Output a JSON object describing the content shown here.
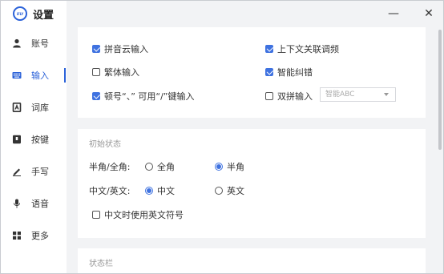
{
  "app": {
    "logo_text": "iFLY",
    "title": "设置"
  },
  "window_controls": {
    "minimize": "—",
    "close": "✕"
  },
  "sidebar": {
    "items": [
      {
        "label": "账号",
        "icon": "user-icon",
        "active": false
      },
      {
        "label": "输入",
        "icon": "keyboard-icon",
        "active": true
      },
      {
        "label": "词库",
        "icon": "dictionary-icon",
        "active": false
      },
      {
        "label": "按键",
        "icon": "key-icon",
        "active": false
      },
      {
        "label": "手写",
        "icon": "pen-icon",
        "active": false
      },
      {
        "label": "语音",
        "icon": "microphone-icon",
        "active": false
      },
      {
        "label": "更多",
        "icon": "grid-icon",
        "active": false
      }
    ]
  },
  "input_options": {
    "pinyin_cloud": {
      "label": "拼音云输入",
      "checked": true
    },
    "context_adjust": {
      "label": "上下文关联调频",
      "checked": true
    },
    "traditional": {
      "label": "繁体输入",
      "checked": false
    },
    "smart_correct": {
      "label": "智能纠错",
      "checked": true
    },
    "punctuation": {
      "label": "顿号“、” 可用“/”键输入",
      "checked": true
    },
    "double_pinyin": {
      "label": "双拼输入",
      "checked": false
    },
    "double_pinyin_scheme": {
      "value": "智能ABC"
    }
  },
  "initial_state": {
    "section_title": "初始状态",
    "width_label": "半角/全角:",
    "full_width": {
      "label": "全角",
      "selected": false
    },
    "half_width": {
      "label": "半角",
      "selected": true
    },
    "lang_label": "中文/英文:",
    "chinese": {
      "label": "中文",
      "selected": true
    },
    "english": {
      "label": "英文",
      "selected": false
    },
    "chinese_with_english_punct": {
      "label": "中文时使用英文符号",
      "checked": false
    }
  },
  "status_bar": {
    "section_title": "状态栏"
  },
  "colors": {
    "accent": "#2b62d9",
    "checkbox": "#3f72e0",
    "background": "#f2f3f5"
  }
}
